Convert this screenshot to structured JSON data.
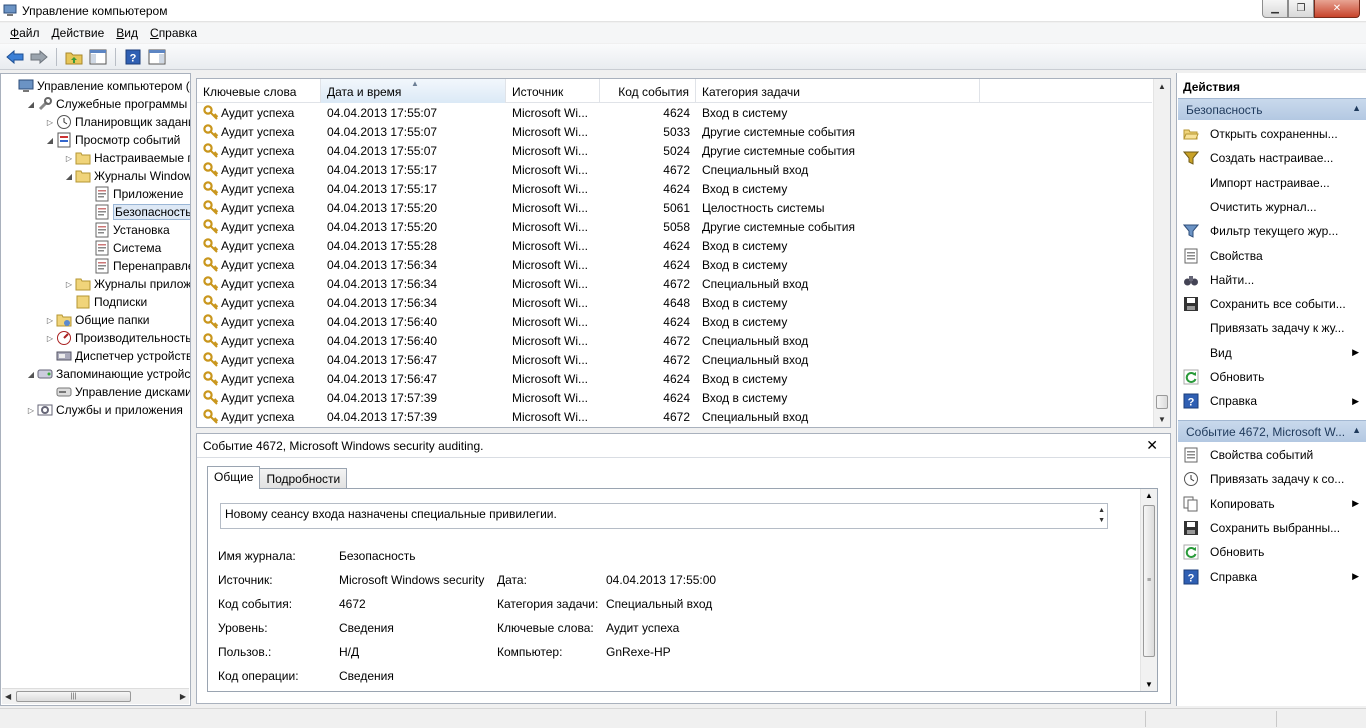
{
  "window": {
    "title": "Управление компьютером"
  },
  "menu": [
    "Файл",
    "Действие",
    "Вид",
    "Справка"
  ],
  "tree": {
    "items": [
      {
        "label": "Управление компьютером (л",
        "level": 0,
        "expander": "",
        "icon": "computer-management-icon"
      },
      {
        "label": "Служебные программы",
        "level": 1,
        "expander": "◢",
        "icon": "tools-icon"
      },
      {
        "label": "Планировщик заданий",
        "level": 2,
        "expander": "▷",
        "icon": "clock-icon"
      },
      {
        "label": "Просмотр событий",
        "level": 2,
        "expander": "◢",
        "icon": "event-viewer-icon"
      },
      {
        "label": "Настраиваемые пр",
        "level": 3,
        "expander": "▷",
        "icon": "folder-icon"
      },
      {
        "label": "Журналы Windows",
        "level": 3,
        "expander": "◢",
        "icon": "folder-icon"
      },
      {
        "label": "Приложение",
        "level": 4,
        "expander": "",
        "icon": "log-icon"
      },
      {
        "label": "Безопасность",
        "level": 4,
        "expander": "",
        "icon": "log-icon",
        "selected": true
      },
      {
        "label": "Установка",
        "level": 4,
        "expander": "",
        "icon": "log-icon"
      },
      {
        "label": "Система",
        "level": 4,
        "expander": "",
        "icon": "log-icon"
      },
      {
        "label": "Перенаправлен",
        "level": 4,
        "expander": "",
        "icon": "log-icon"
      },
      {
        "label": "Журналы приложе",
        "level": 3,
        "expander": "▷",
        "icon": "folder-icon"
      },
      {
        "label": "Подписки",
        "level": 3,
        "expander": "",
        "icon": "subscriptions-icon"
      },
      {
        "label": "Общие папки",
        "level": 2,
        "expander": "▷",
        "icon": "shared-folder-icon"
      },
      {
        "label": "Производительность",
        "level": 2,
        "expander": "▷",
        "icon": "performance-icon"
      },
      {
        "label": "Диспетчер устройств",
        "level": 2,
        "expander": "",
        "icon": "device-manager-icon"
      },
      {
        "label": "Запоминающие устройст",
        "level": 1,
        "expander": "◢",
        "icon": "storage-icon"
      },
      {
        "label": "Управление дисками",
        "level": 2,
        "expander": "",
        "icon": "disk-icon"
      },
      {
        "label": "Службы и приложения",
        "level": 1,
        "expander": "▷",
        "icon": "services-icon"
      }
    ],
    "scroll_grip": "|||"
  },
  "events": {
    "columns": [
      "Ключевые слова",
      "Дата и время",
      "Источник",
      "Код события",
      "Категория задачи"
    ],
    "rows": [
      [
        "Аудит успеха",
        "04.04.2013 17:55:07",
        "Microsoft Wi...",
        "4624",
        "Вход в систему"
      ],
      [
        "Аудит успеха",
        "04.04.2013 17:55:07",
        "Microsoft Wi...",
        "5033",
        "Другие системные события"
      ],
      [
        "Аудит успеха",
        "04.04.2013 17:55:07",
        "Microsoft Wi...",
        "5024",
        "Другие системные события"
      ],
      [
        "Аудит успеха",
        "04.04.2013 17:55:17",
        "Microsoft Wi...",
        "4672",
        "Специальный вход"
      ],
      [
        "Аудит успеха",
        "04.04.2013 17:55:17",
        "Microsoft Wi...",
        "4624",
        "Вход в систему"
      ],
      [
        "Аудит успеха",
        "04.04.2013 17:55:20",
        "Microsoft Wi...",
        "5061",
        "Целостность системы"
      ],
      [
        "Аудит успеха",
        "04.04.2013 17:55:20",
        "Microsoft Wi...",
        "5058",
        "Другие системные события"
      ],
      [
        "Аудит успеха",
        "04.04.2013 17:55:28",
        "Microsoft Wi...",
        "4624",
        "Вход в систему"
      ],
      [
        "Аудит успеха",
        "04.04.2013 17:56:34",
        "Microsoft Wi...",
        "4624",
        "Вход в систему"
      ],
      [
        "Аудит успеха",
        "04.04.2013 17:56:34",
        "Microsoft Wi...",
        "4672",
        "Специальный вход"
      ],
      [
        "Аудит успеха",
        "04.04.2013 17:56:34",
        "Microsoft Wi...",
        "4648",
        "Вход в систему"
      ],
      [
        "Аудит успеха",
        "04.04.2013 17:56:40",
        "Microsoft Wi...",
        "4624",
        "Вход в систему"
      ],
      [
        "Аудит успеха",
        "04.04.2013 17:56:40",
        "Microsoft Wi...",
        "4672",
        "Специальный вход"
      ],
      [
        "Аудит успеха",
        "04.04.2013 17:56:47",
        "Microsoft Wi...",
        "4672",
        "Специальный вход"
      ],
      [
        "Аудит успеха",
        "04.04.2013 17:56:47",
        "Microsoft Wi...",
        "4624",
        "Вход в систему"
      ],
      [
        "Аудит успеха",
        "04.04.2013 17:57:39",
        "Microsoft Wi...",
        "4624",
        "Вход в систему"
      ],
      [
        "Аудит успеха",
        "04.04.2013 17:57:39",
        "Microsoft Wi...",
        "4672",
        "Специальный вход"
      ]
    ]
  },
  "detail": {
    "header": "Событие 4672, Microsoft Windows security auditing.",
    "close": "✕",
    "tabs": [
      "Общие",
      "Подробности"
    ],
    "message": "Новому сеансу входа назначены специальные привилегии.",
    "fields": {
      "log_label": "Имя журнала:",
      "log_value": "Безопасность",
      "source_label": "Источник:",
      "source_value": "Microsoft Windows security",
      "date_label": "Дата:",
      "date_value": "04.04.2013 17:55:00",
      "eventid_label": "Код события:",
      "eventid_value": "4672",
      "category_label": "Категория задачи:",
      "category_value": "Специальный вход",
      "level_label": "Уровень:",
      "level_value": "Сведения",
      "keywords_label": "Ключевые слова:",
      "keywords_value": "Аудит успеха",
      "user_label": "Пользов.:",
      "user_value": "Н/Д",
      "computer_label": "Компьютер:",
      "computer_value": "GnRexe-HP",
      "opcode_label": "Код операции:",
      "opcode_value": "Сведения"
    }
  },
  "actions": {
    "title": "Действия",
    "section1": "Безопасность",
    "items1": [
      {
        "label": "Открыть сохраненны...",
        "icon": "open-folder-icon"
      },
      {
        "label": "Создать настраивае...",
        "icon": "filter-new-icon"
      },
      {
        "label": "Импорт настраивае...",
        "icon": ""
      },
      {
        "label": "Очистить журнал...",
        "icon": ""
      },
      {
        "label": "Фильтр текущего жур...",
        "icon": "filter-icon"
      },
      {
        "label": "Свойства",
        "icon": "properties-icon"
      },
      {
        "label": "Найти...",
        "icon": "binoculars-icon"
      },
      {
        "label": "Сохранить все событи...",
        "icon": "save-icon"
      },
      {
        "label": "Привязать задачу к жу...",
        "icon": ""
      },
      {
        "label": "Вид",
        "icon": "",
        "submenu": "▶"
      },
      {
        "label": "Обновить",
        "icon": "refresh-icon"
      },
      {
        "label": "Справка",
        "icon": "help-icon",
        "submenu": "▶"
      }
    ],
    "section2": "Событие 4672, Microsoft W...",
    "items2": [
      {
        "label": "Свойства событий",
        "icon": "properties-icon"
      },
      {
        "label": "Привязать задачу к со...",
        "icon": "task-icon"
      },
      {
        "label": "Копировать",
        "icon": "copy-icon",
        "submenu": "▶"
      },
      {
        "label": "Сохранить выбранны...",
        "icon": "save-icon"
      },
      {
        "label": "Обновить",
        "icon": "refresh-icon"
      },
      {
        "label": "Справка",
        "icon": "help-icon",
        "submenu": "▶"
      }
    ]
  }
}
